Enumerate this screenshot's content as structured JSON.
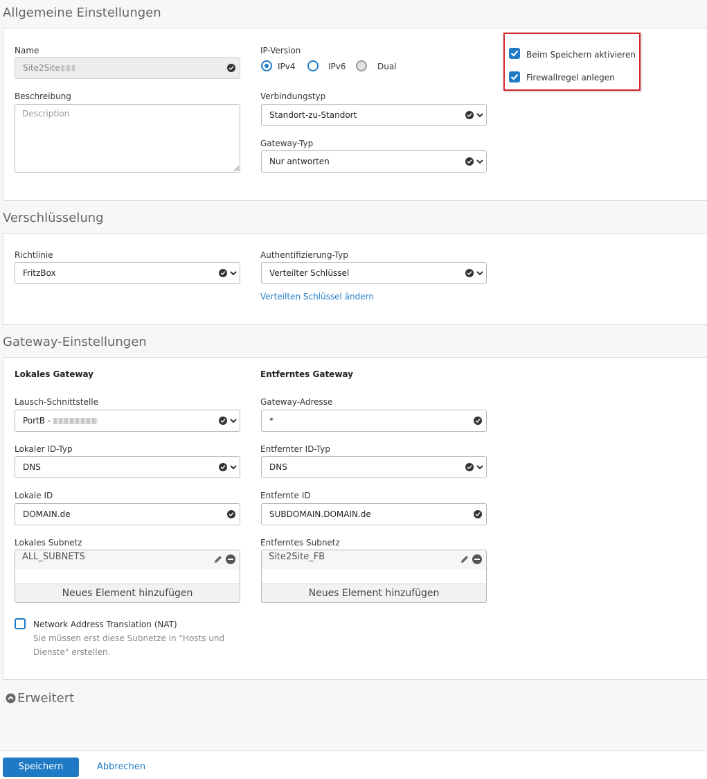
{
  "general": {
    "title": "Allgemeine Einstellungen",
    "name_label": "Name",
    "name_value": "Site2Site",
    "description_label": "Beschreibung",
    "description_placeholder": "Description",
    "ip_version_label": "IP-Version",
    "ip_options": [
      "IPv4",
      "IPv6",
      "Dual"
    ],
    "ip_selected": "IPv4",
    "connection_type_label": "Verbindungstyp",
    "connection_type_value": "Standort-zu-Standort",
    "gateway_type_label": "Gateway-Typ",
    "gateway_type_value": "Nur antworten",
    "activate_on_save_label": "Beim Speichern aktivieren",
    "activate_on_save_checked": true,
    "firewall_rule_label": "Firewallregel anlegen",
    "firewall_rule_checked": true
  },
  "encryption": {
    "title": "Verschlüsselung",
    "policy_label": "Richtlinie",
    "policy_value": "FritzBox",
    "auth_type_label": "Authentifizierung-Typ",
    "auth_type_value": "Verteilter Schlüssel",
    "change_key_link": "Verteilten Schlüssel ändern"
  },
  "gateway": {
    "title": "Gateway-Einstellungen",
    "local_heading": "Lokales Gateway",
    "remote_heading": "Entferntes Gateway",
    "listen_interface_label": "Lausch-Schnittstelle",
    "listen_interface_value": "PortB - ",
    "gateway_address_label": "Gateway-Adresse",
    "gateway_address_value": "*",
    "local_id_type_label": "Lokaler ID-Typ",
    "local_id_type_value": "DNS",
    "remote_id_type_label": "Entfernter ID-Typ",
    "remote_id_type_value": "DNS",
    "local_id_label": "Lokale ID",
    "local_id_value": "DOMAIN.de",
    "remote_id_label": "Entfernte ID",
    "remote_id_value": "SUBDOMAIN.DOMAIN.de",
    "local_subnet_label": "Lokales Subnetz",
    "local_subnet_items": [
      "ALL_SUBNETS"
    ],
    "remote_subnet_label": "Entferntes Subnetz",
    "remote_subnet_items": [
      "Site2Site_FB"
    ],
    "add_item_label": "Neues Element hinzufügen",
    "nat_label": "Network Address Translation (NAT)",
    "nat_checked": false,
    "nat_hint_line1": "Sie müssen erst diese Subnetze in \"Hosts und",
    "nat_hint_line2": "Dienste\" erstellen."
  },
  "advanced": {
    "title": "Erweitert"
  },
  "footer": {
    "save_label": "Speichern",
    "cancel_label": "Abbrechen"
  },
  "colors": {
    "accent": "#1f7ac5",
    "highlight_border": "#d9232b"
  }
}
